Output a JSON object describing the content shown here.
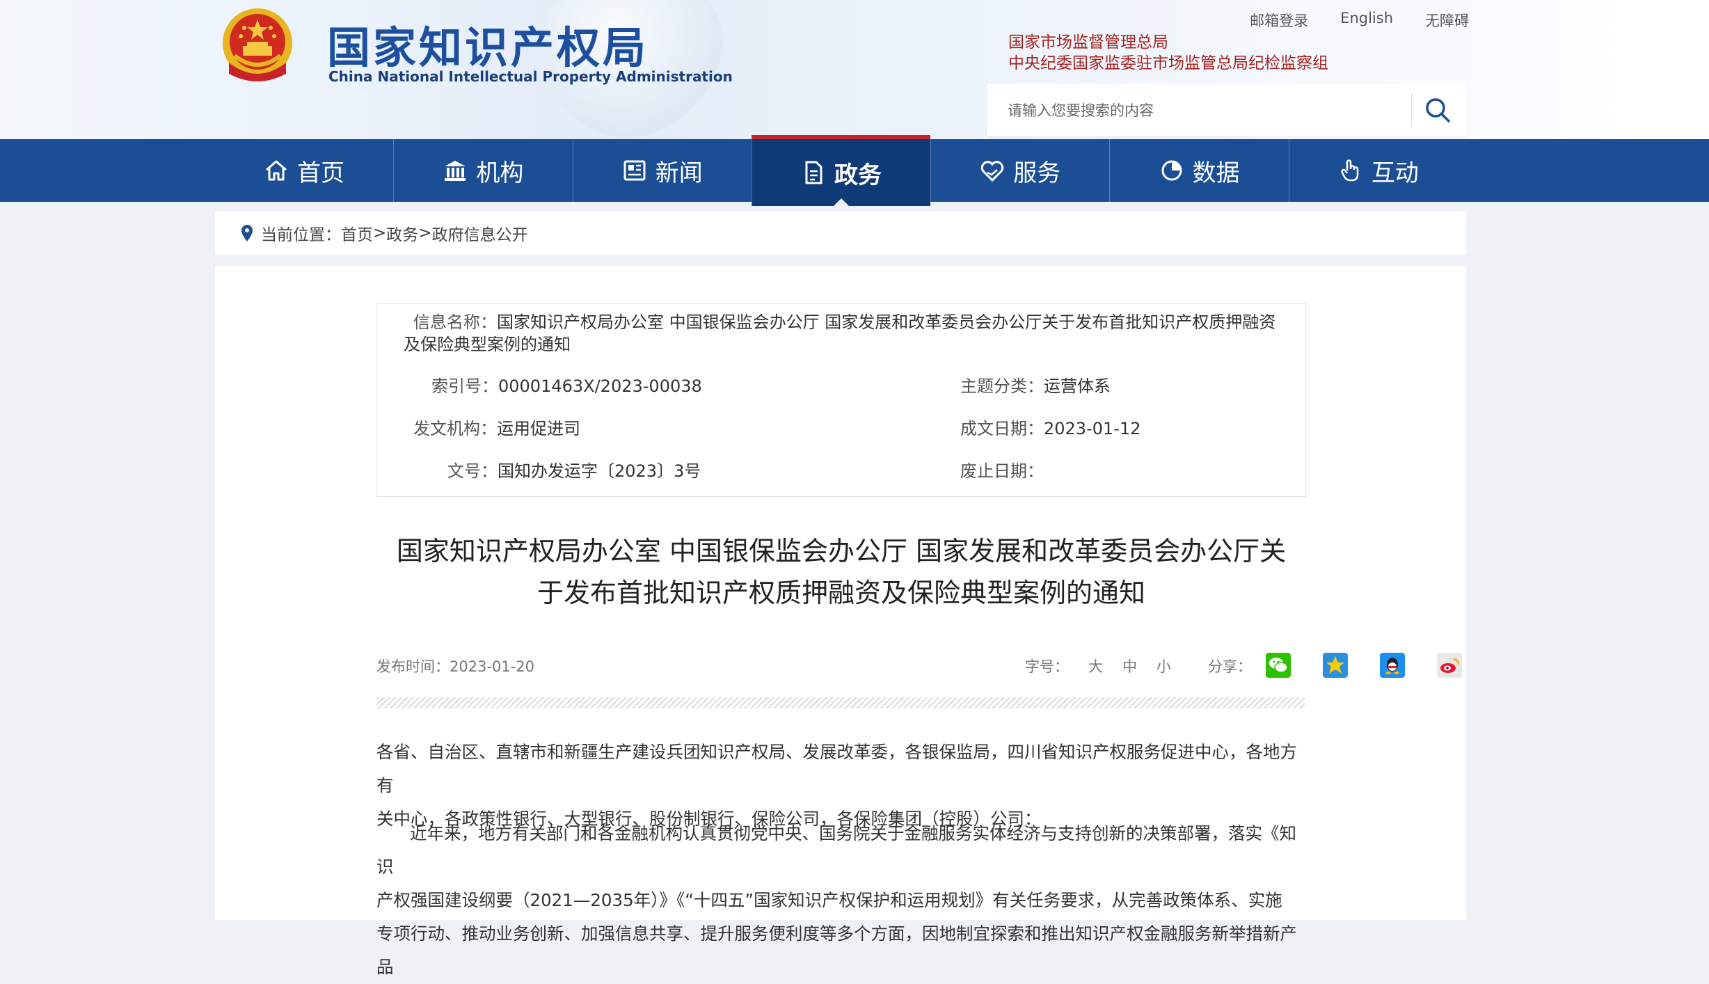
{
  "header": {
    "title_cn": "国家知识产权局",
    "title_en": "China National Intellectual Property Administration",
    "toplinks": [
      "邮箱登录",
      "English",
      "无障碍"
    ],
    "parent_org": "国家市场监督管理总局",
    "supervision": "中央纪委国家监委驻市场监管总局纪检监察组",
    "search_placeholder": "请输入您要搜索的内容"
  },
  "nav": {
    "items": [
      {
        "label": "首页",
        "icon": "home-icon"
      },
      {
        "label": "机构",
        "icon": "institution-icon"
      },
      {
        "label": "新闻",
        "icon": "news-icon"
      },
      {
        "label": "政务",
        "icon": "document-icon"
      },
      {
        "label": "服务",
        "icon": "service-icon"
      },
      {
        "label": "数据",
        "icon": "pie-chart-icon"
      },
      {
        "label": "互动",
        "icon": "hand-pointer-icon"
      }
    ],
    "active": "政务"
  },
  "breadcrumb": {
    "prefix": "当前位置：",
    "items": [
      "首页",
      "政务",
      "政府信息公开"
    ],
    "sep": ">"
  },
  "meta": {
    "name_label": "信息名称：",
    "name_value": "国家知识产权局办公室 中国银保监会办公厅 国家发展和改革委员会办公厅关于发布首批知识产权质押融资",
    "name_value_2": "及保险典型案例的通知",
    "index_label": "索引号：",
    "index_value": "00001463X/2023-00038",
    "topic_label": "主题分类：",
    "topic_value": "运营体系",
    "org_label": "发文机构：",
    "org_value": "运用促进司",
    "date_label": "成文日期：",
    "date_value": "2023-01-12",
    "docno_label": "文号：",
    "docno_value": "国知办发运字〔2023〕3号",
    "abolish_label": "废止日期：",
    "abolish_value": ""
  },
  "article": {
    "title_line1": "国家知识产权局办公室 中国银保监会办公厅 国家发展和改革委员会办公厅关",
    "title_line2": "于发布首批知识产权质押融资及保险典型案例的通知",
    "publish": "发布时间：2023-01-20",
    "font_label": "字号：",
    "font_sizes": [
      "大",
      "中",
      "小"
    ],
    "share_label": "分享：",
    "share_icons": [
      "wechat-icon",
      "qzone-icon",
      "qq-icon",
      "weibo-icon"
    ],
    "p1_line1": "各省、自治区、直辖市和新疆生产建设兵团知识产权局、发展改革委，各银保监局，四川省知识产权服务促进中心，各地方有",
    "p1_line2": "关中心，各政策性银行、大型银行、股份制银行、保险公司，各保险集团（控股）公司：",
    "p2_line1": "近年来，地方有关部门和各金融机构认真贯彻党中央、国务院关于金融服务实体经济与支持创新的决策部署，落实《知识",
    "p2_line2": "产权强国建设纲要（2021—2035年）》《“十四五”国家知识产权保护和运用规划》有关任务要求，从完善政策体系、实施",
    "p2_line3": "专项行动、推动业务创新、加强信息共享、提升服务便利度等多个方面，因地制宜探索和推出知识产权金融服务新举措新产品"
  },
  "colors": {
    "nav_bg": "#1c4e95",
    "nav_active": "#0f3a78",
    "accent_red": "#c8222a",
    "title_blue": "#1d4f9f"
  }
}
